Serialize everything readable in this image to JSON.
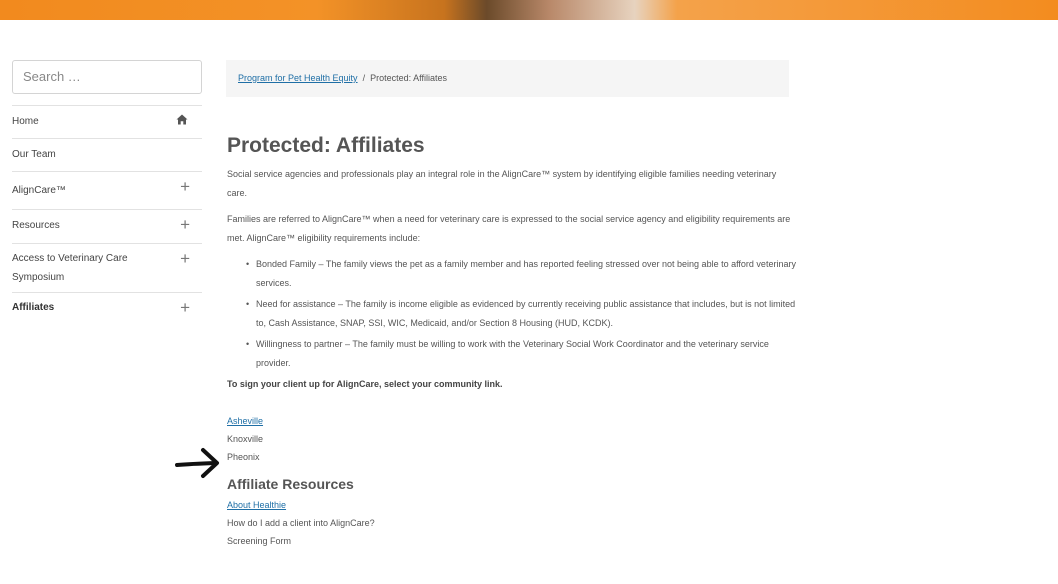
{
  "search": {
    "placeholder": "Search …"
  },
  "sidebar": {
    "items": [
      {
        "label": "Home",
        "icon": "home-icon"
      },
      {
        "label": "Our Team"
      },
      {
        "label": "AlignCare™",
        "icon": "plus-icon"
      },
      {
        "label": "Resources",
        "icon": "plus-icon"
      },
      {
        "label": "Access to Veterinary Care Symposium",
        "icon": "plus-icon"
      },
      {
        "label": "Affiliates",
        "icon": "plus-icon"
      }
    ]
  },
  "breadcrumb": {
    "parent": "Program for Pet Health Equity",
    "separator": "/",
    "current": "Protected: Affiliates"
  },
  "main": {
    "title": "Protected: Affiliates",
    "intro": "Social service agencies and professionals play an integral role in the AlignCare™ system by identifying eligible families needing veterinary care.",
    "referral": "Families are referred to AlignCare™ when a need for veterinary care is expressed to the social service agency and eligibility requirements are met. AlignCare™ eligibility requirements include:",
    "requirements": [
      "Bonded Family – The family views the pet as a family member and has reported feeling stressed over not being able to afford veterinary services.",
      "Need for assistance – The family is income eligible as evidenced by currently receiving public assistance that includes, but is not limited to, Cash Assistance, SNAP, SSI, WIC, Medicaid, and/or Section 8 Housing (HUD, KCDK).",
      "Willingness to partner – The family must be willing to work with the Veterinary Social Work Coordinator and the veterinary service provider."
    ],
    "signup": "To sign your client up for AlignCare, select your community link.",
    "communities": [
      "Asheville",
      "Knoxville",
      "Pheonix"
    ],
    "resources_heading": "Affiliate Resources",
    "resources": [
      "About Healthie",
      "How do I add a client into AlignCare?",
      "Screening Form"
    ]
  },
  "colors": {
    "accent": "#f28a1e",
    "link": "#1f6fa6"
  }
}
